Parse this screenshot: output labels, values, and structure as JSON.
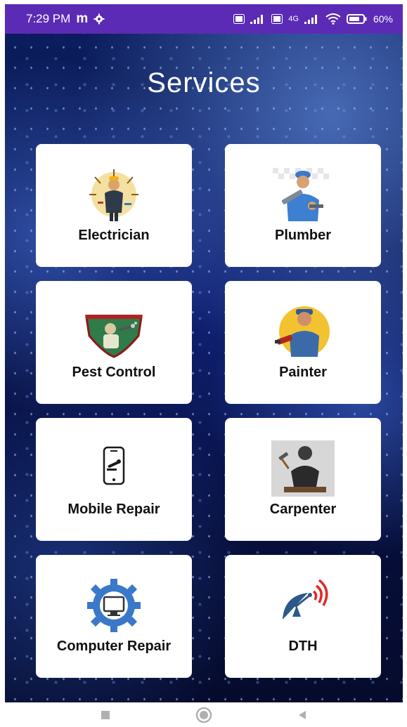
{
  "status_bar": {
    "time": "7:29 PM",
    "app_letter": "m",
    "volte1": "Vo LTE",
    "volte2": "Vo LTE",
    "network": "4G",
    "battery": "60%"
  },
  "title": "Services",
  "services": [
    {
      "label": "Electrician",
      "icon": "electrician-icon"
    },
    {
      "label": "Plumber",
      "icon": "plumber-icon"
    },
    {
      "label": "Pest Control",
      "icon": "pest-control-icon"
    },
    {
      "label": "Painter",
      "icon": "painter-icon"
    },
    {
      "label": "Mobile Repair",
      "icon": "mobile-repair-icon"
    },
    {
      "label": "Carpenter",
      "icon": "carpenter-icon"
    },
    {
      "label": "Computer Repair",
      "icon": "computer-repair-icon"
    },
    {
      "label": "DTH",
      "icon": "dth-icon"
    }
  ],
  "nav": {
    "recents_icon": "square-icon",
    "home_icon": "circle-icon",
    "back_icon": "triangle-back-icon"
  }
}
